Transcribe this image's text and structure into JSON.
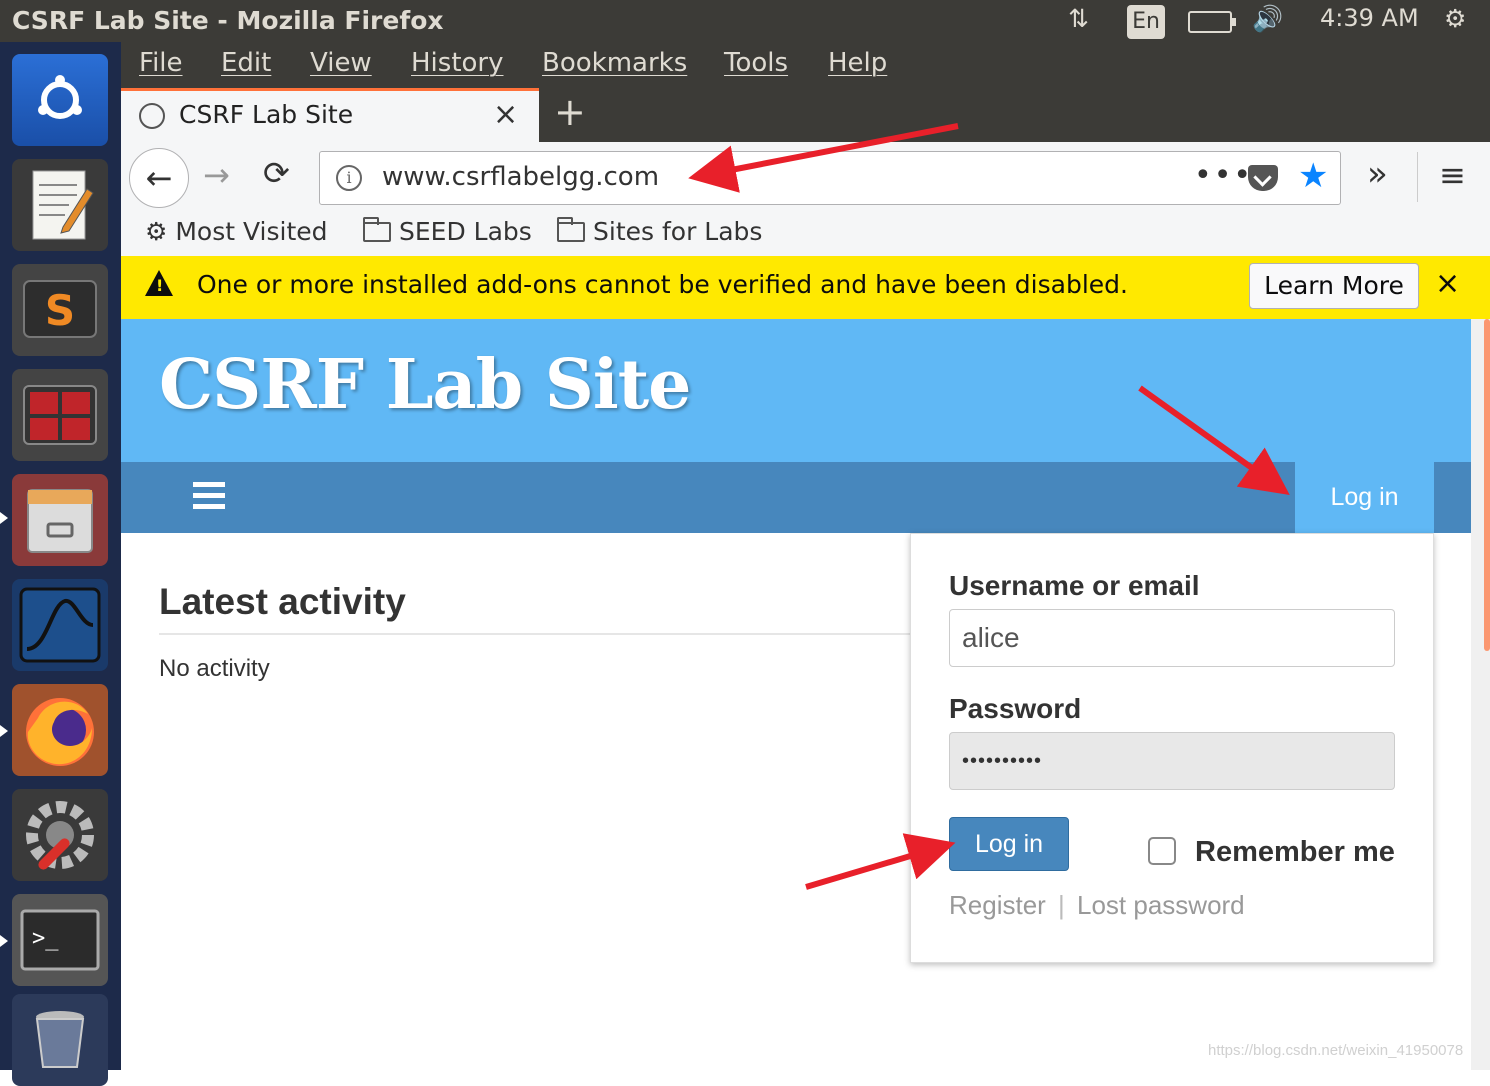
{
  "window": {
    "title": "CSRF Lab Site - Mozilla Firefox"
  },
  "system_tray": {
    "keyboard_lang": "En",
    "clock": "4:39 AM",
    "icons": [
      "network-icon",
      "battery-icon",
      "volume-icon",
      "settings-gear-icon"
    ]
  },
  "launcher": {
    "items": [
      {
        "name": "ubuntu-dash",
        "icon": "ubuntu-logo-icon"
      },
      {
        "name": "text-editor",
        "icon": "text-editor-icon"
      },
      {
        "name": "sublime-text",
        "icon": "sublime-icon"
      },
      {
        "name": "terminal-multiplexer",
        "icon": "workspace-icon"
      },
      {
        "name": "file-manager",
        "icon": "file-cabinet-icon"
      },
      {
        "name": "wireshark",
        "icon": "wireshark-fin-icon"
      },
      {
        "name": "firefox",
        "icon": "firefox-icon"
      },
      {
        "name": "system-settings",
        "icon": "settings-wrench-icon"
      },
      {
        "name": "terminal",
        "icon": "terminal-icon"
      },
      {
        "name": "trash",
        "icon": "trash-icon"
      }
    ]
  },
  "menubar": {
    "items": [
      "File",
      "Edit",
      "View",
      "History",
      "Bookmarks",
      "Tools",
      "Help"
    ]
  },
  "tabs": [
    {
      "label": "CSRF Lab Site",
      "close": "×"
    }
  ],
  "newtab_label": "+",
  "navbar": {
    "back": "←",
    "forward": "→",
    "reload": "⟳",
    "url": "www.csrflabelgg.com",
    "page_actions": "•••",
    "overflow": "»",
    "menu": "≡"
  },
  "bookmarks": [
    {
      "label": "Most Visited",
      "icon": "gear-icon"
    },
    {
      "label": "SEED Labs",
      "icon": "folder-icon"
    },
    {
      "label": "Sites for Labs",
      "icon": "folder-icon"
    }
  ],
  "notification": {
    "message": "One or more installed add-ons cannot be verified and have been disabled.",
    "button": "Learn More",
    "close": "×"
  },
  "site": {
    "title": "CSRF Lab Site",
    "nav_login": "Log in",
    "heading": "Latest activity",
    "empty_text": "No activity"
  },
  "login_form": {
    "username_label": "Username or email",
    "username_value": "alice",
    "password_label": "Password",
    "password_value": "••••••••••",
    "submit": "Log in",
    "remember": "Remember me",
    "register": "Register",
    "separator": "|",
    "lost_password": "Lost password"
  },
  "watermark": "https://blog.csdn.net/weixin_41950078",
  "colors": {
    "header": "#60b8f5",
    "navbar": "#4787bd",
    "notice": "#ffe900",
    "arrow": "#e8202a"
  }
}
